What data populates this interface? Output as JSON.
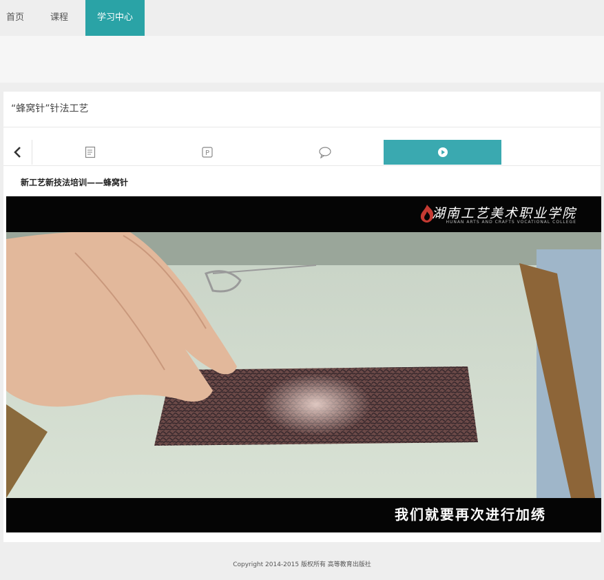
{
  "nav": {
    "items": [
      {
        "label": "首页"
      },
      {
        "label": "课程"
      },
      {
        "label": "学习中心"
      }
    ],
    "active_color": "#2aa3a6"
  },
  "page": {
    "title": "“蜂窝针”针法工艺"
  },
  "tabs": {
    "back_icon": "chevron-left-icon",
    "items": [
      {
        "icon": "document-icon"
      },
      {
        "icon": "ppt-icon"
      },
      {
        "icon": "comment-icon"
      },
      {
        "icon": "play-icon"
      }
    ],
    "active_color": "#3aa9b0"
  },
  "video": {
    "title": "新工艺新技法培训——蜂窝针",
    "logo_text": "湖南工艺美术职业学院",
    "logo_sub": "HUNAN ARTS AND CRAFTS VOCATIONAL COLLEGE",
    "subtitle": "我们就要再次进行加绣"
  },
  "footer": {
    "copyright": "Copyright 2014-2015 版权所有 高等教育出版社"
  }
}
